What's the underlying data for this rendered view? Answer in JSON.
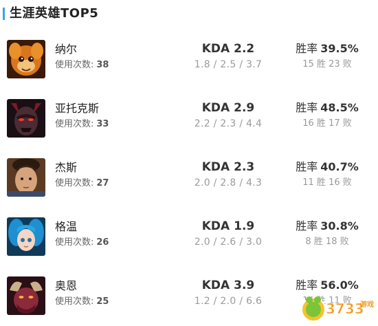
{
  "header": {
    "title": "生涯英雄TOP5",
    "accent": "#3aa0e6"
  },
  "uses_label": "使用次数:",
  "kda_prefix": "KDA",
  "winrate_label": "胜率",
  "win_char": "胜",
  "loss_char": "败",
  "heroes": [
    {
      "name": "纳尔",
      "uses": "38",
      "kda": "KDA 2.2",
      "kda_detail": "1.8 / 2.5 / 3.7",
      "winrate": "39.5%",
      "wins": "15",
      "losses": "23",
      "portrait": "gnar-portrait-icon"
    },
    {
      "name": "亚托克斯",
      "uses": "33",
      "kda": "KDA 2.9",
      "kda_detail": "2.2 / 2.3 / 4.4",
      "winrate": "48.5%",
      "wins": "16",
      "losses": "17",
      "portrait": "aatrox-portrait-icon"
    },
    {
      "name": "杰斯",
      "uses": "27",
      "kda": "KDA 2.3",
      "kda_detail": "2.0 / 2.8 / 4.3",
      "winrate": "40.7%",
      "wins": "11",
      "losses": "16",
      "portrait": "jayce-portrait-icon"
    },
    {
      "name": "格温",
      "uses": "26",
      "kda": "KDA 1.9",
      "kda_detail": "2.0 / 2.6 / 3.0",
      "winrate": "30.8%",
      "wins": "8",
      "losses": "18",
      "portrait": "gwen-portrait-icon"
    },
    {
      "name": "奥恩",
      "uses": "25",
      "kda": "KDA 3.9",
      "kda_detail": "1.2 / 2.0 / 6.6",
      "winrate": "56.0%",
      "wins": "14",
      "losses": "11",
      "portrait": "ornn-portrait-icon"
    }
  ],
  "watermark": {
    "text": "3733游戏",
    "logo": "3733-logo-icon"
  }
}
